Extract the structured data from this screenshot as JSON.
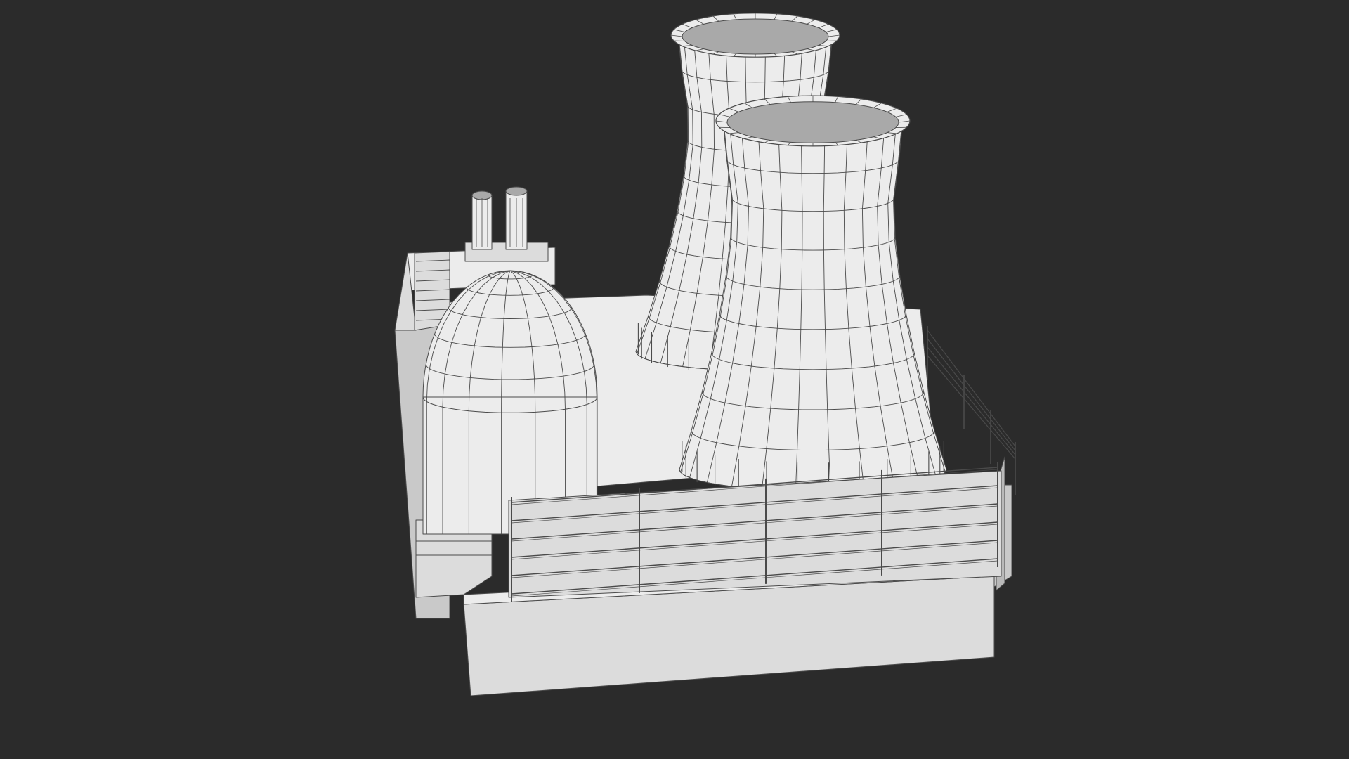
{
  "colors": {
    "background": "#2b2b2b",
    "surface_light": "#ececec",
    "surface_mid": "#dcdcdc",
    "surface_shadow": "#c9c9c9",
    "surface_dark": "#b9b9b9",
    "inner_dark": "#a9a9a9",
    "wire": "#4a4a4a"
  },
  "model": {
    "cooling_towers": {
      "count": 2,
      "radial_segments": 24,
      "height_rings": 9
    },
    "reactor_dome": {
      "radial_segments": 16,
      "dome_rings": 5
    },
    "chimneys": {
      "count": 2
    },
    "railing": {
      "rails": 6
    }
  }
}
